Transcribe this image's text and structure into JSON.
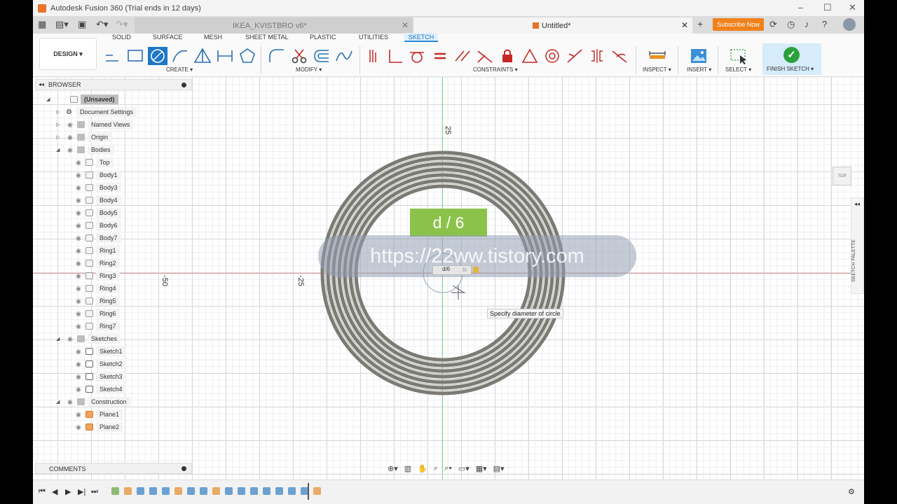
{
  "window": {
    "title": "Autodesk Fusion 360 (Trial ends in 12 days)",
    "controls": [
      "–",
      "☐",
      "✕"
    ]
  },
  "tabs": [
    {
      "label": "IKEA_KVISTBRO v6*",
      "active": false
    },
    {
      "label": "Untitled*",
      "active": true
    }
  ],
  "header": {
    "subscribe_label": "Subscribe Now",
    "plus": "+",
    "close": "✕"
  },
  "ribbon": {
    "workspace": "DESIGN",
    "tabs": [
      "SOLID",
      "SURFACE",
      "MESH",
      "SHEET METAL",
      "PLASTIC",
      "UTILITIES",
      "SKETCH"
    ],
    "active_tab": "SKETCH",
    "groups": {
      "create": "CREATE",
      "modify": "MODIFY",
      "constraints": "CONSTRAINTS",
      "inspect": "INSPECT",
      "insert": "INSERT",
      "select": "SELECT",
      "finish": "FINISH SKETCH"
    },
    "accent": "#2a8ad8"
  },
  "browser": {
    "title": "BROWSER",
    "root": "(Unsaved)",
    "items": [
      {
        "label": "Document Settings",
        "icon": "gear-icon"
      },
      {
        "label": "Named Views",
        "icon": "folder-icon"
      },
      {
        "label": "Origin",
        "icon": "folder-icon"
      },
      {
        "label": "Bodies",
        "icon": "folder-icon"
      },
      {
        "label": "Top",
        "icon": "body-icon"
      },
      {
        "label": "Body1",
        "icon": "body-icon"
      },
      {
        "label": "Body3",
        "icon": "body-icon"
      },
      {
        "label": "Body4",
        "icon": "body-icon"
      },
      {
        "label": "Body5",
        "icon": "body-icon"
      },
      {
        "label": "Body6",
        "icon": "body-icon"
      },
      {
        "label": "Body7",
        "icon": "body-icon"
      },
      {
        "label": "Ring1",
        "icon": "body-icon"
      },
      {
        "label": "Ring2",
        "icon": "body-icon"
      },
      {
        "label": "Ring3",
        "icon": "body-icon"
      },
      {
        "label": "Ring4",
        "icon": "body-icon"
      },
      {
        "label": "Ring5",
        "icon": "body-icon"
      },
      {
        "label": "Ring6",
        "icon": "body-icon"
      },
      {
        "label": "Ring7",
        "icon": "body-icon"
      },
      {
        "label": "Sketches",
        "icon": "folder-icon"
      },
      {
        "label": "Sketch1",
        "icon": "sketch-icon"
      },
      {
        "label": "Sketch2",
        "icon": "sketch-icon"
      },
      {
        "label": "Sketch3",
        "icon": "sketch-icon"
      },
      {
        "label": "Sketch4",
        "icon": "sketch-icon"
      },
      {
        "label": "Construction",
        "icon": "folder-icon"
      },
      {
        "label": "Plane1",
        "icon": "plane-icon"
      },
      {
        "label": "Plane2",
        "icon": "plane-icon"
      }
    ]
  },
  "comments": {
    "title": "COMMENTS"
  },
  "canvas": {
    "axis_labels": [
      "25",
      "-50",
      "-25"
    ],
    "dimension_input": {
      "value": "d/6",
      "fx": "fx"
    },
    "tooltip": "Specify diameter of circle",
    "viewcube": "TOP",
    "palette": "SKETCH PALETTE"
  },
  "overlays": {
    "badge": "d / 6",
    "watermark": "https://22ww.tistory.com"
  }
}
